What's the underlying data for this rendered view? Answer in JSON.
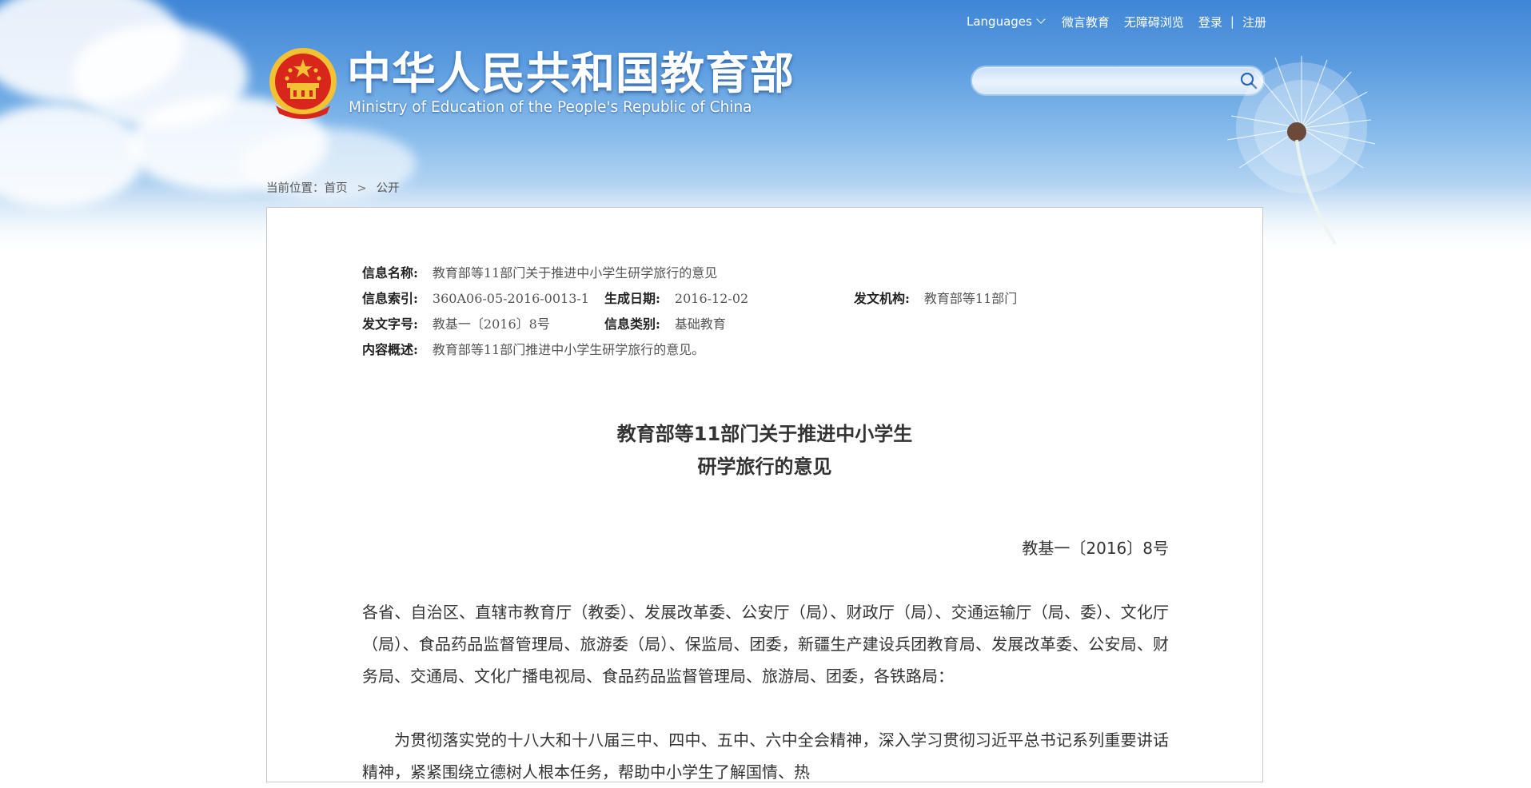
{
  "header": {
    "title_cn": "中华人民共和国教育部",
    "title_en": "Ministry of Education of the People's Republic of China",
    "nav": {
      "languages": "Languages",
      "weiyan": "微言教育",
      "accessibility": "无障碍浏览",
      "login": "登录",
      "separator": "|",
      "register": "注册"
    },
    "search": {
      "placeholder": "",
      "value": ""
    }
  },
  "breadcrumb": {
    "prefix": "当前位置：",
    "home": "首页",
    "separator": ">",
    "current": "公开"
  },
  "meta": {
    "name_label": "信息名称:",
    "name_value": "教育部等11部门关于推进中小学生研学旅行的意见",
    "index_label": "信息索引:",
    "index_value": "360A06-05-2016-0013-1",
    "date_label": "生成日期:",
    "date_value": "2016-12-02",
    "org_label": "发文机构:",
    "org_value": "教育部等11部门",
    "docno_label": "发文字号:",
    "docno_value": "教基一〔2016〕8号",
    "category_label": "信息类别:",
    "category_value": "基础教育",
    "summary_label": "内容概述:",
    "summary_value": "教育部等11部门推进中小学生研学旅行的意见。"
  },
  "document": {
    "title_line1": "教育部等11部门关于推进中小学生",
    "title_line2": "研学旅行的意见",
    "doc_number": "教基一〔2016〕8号",
    "para1": "各省、自治区、直辖市教育厅（教委）、发展改革委、公安厅（局）、财政厅（局）、交通运输厅（局、委）、文化厅（局）、食品药品监督管理局、旅游委（局）、保监局、团委，新疆生产建设兵团教育局、发展改革委、公安局、财务局、交通局、文化广播电视局、食品药品监督管理局、旅游局、团委，各铁路局：",
    "para2": "为贯彻落实党的十八大和十八届三中、四中、五中、六中全会精神，深入学习贯彻习近平总书记系列重要讲话精神，紧紧围绕立德树人根本任务，帮助中小学生了解国情、热"
  },
  "colors": {
    "sky_top": "#3f86d6",
    "accent_red": "#d9261c",
    "gold": "#f2c232"
  }
}
